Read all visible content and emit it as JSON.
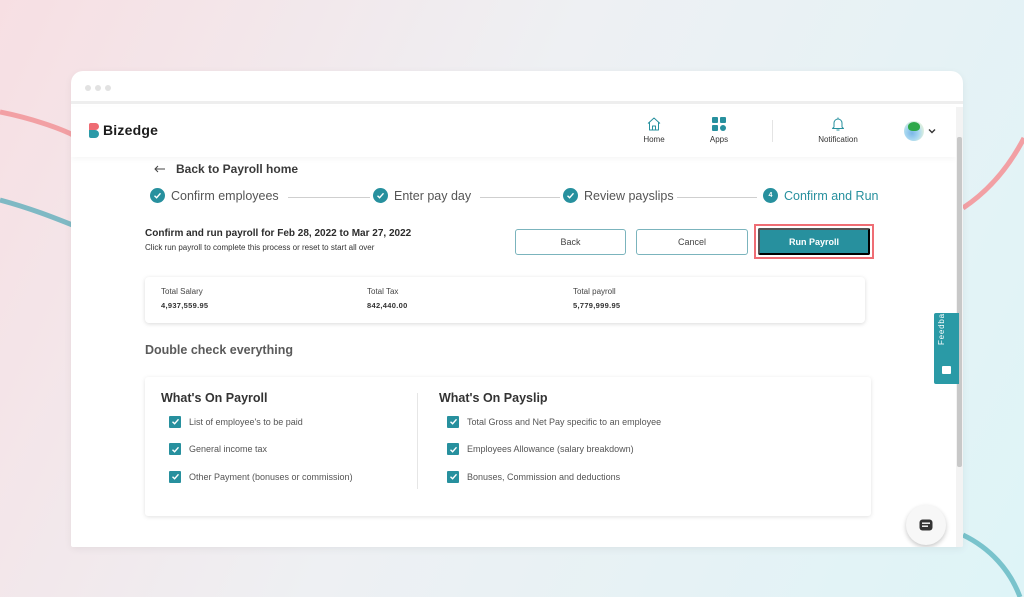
{
  "colors": {
    "accent": "#27909e",
    "highlight": "#ef6d74",
    "logo_red": "#ee6b73",
    "logo_teal": "#2b9aa8"
  },
  "app": {
    "brand": "Bizedge"
  },
  "header": {
    "nav": [
      {
        "label": "Home",
        "icon": "home-icon"
      },
      {
        "label": "Apps",
        "icon": "apps-grid-icon"
      },
      {
        "label": "Notification",
        "icon": "bell-icon"
      }
    ],
    "avatar_icon": "avatar",
    "dropdown_icon": "chevron-down-icon"
  },
  "page": {
    "back_link": "Back to Payroll home",
    "steps": [
      {
        "label": "Confirm employees",
        "status": "completed"
      },
      {
        "label": "Enter pay day",
        "status": "completed"
      },
      {
        "label": "Review payslips",
        "status": "completed"
      },
      {
        "label": "Confirm and Run",
        "status": "active",
        "number": "4"
      }
    ],
    "confirm_title": "Confirm and run payroll for Feb 28, 2022 to Mar 27, 2022",
    "confirm_subtitle": "Click run payroll to complete this process or reset to start all over",
    "buttons": {
      "back": "Back",
      "cancel": "Cancel",
      "run": "Run Payroll"
    },
    "totals": [
      {
        "label": "Total Salary",
        "value": "4,937,559.95"
      },
      {
        "label": "Total Tax",
        "value": "842,440.00"
      },
      {
        "label": "Total payroll",
        "value": "5,779,999.95"
      }
    ],
    "double_check_title": "Double check everything",
    "payroll_section": {
      "title": "What's On Payroll",
      "items": [
        {
          "label": "List of employee's to be paid",
          "checked": true
        },
        {
          "label": "General income tax",
          "checked": true
        },
        {
          "label": "Other Payment (bonuses or commission)",
          "checked": true
        }
      ]
    },
    "payslip_section": {
      "title": "What's On Payslip",
      "items": [
        {
          "label": "Total Gross and Net Pay specific to an employee",
          "checked": true
        },
        {
          "label": "Employees Allowance (salary breakdown)",
          "checked": true
        },
        {
          "label": "Bonuses, Commission and deductions",
          "checked": true
        }
      ]
    }
  },
  "feedback": {
    "label": "Feedback"
  }
}
